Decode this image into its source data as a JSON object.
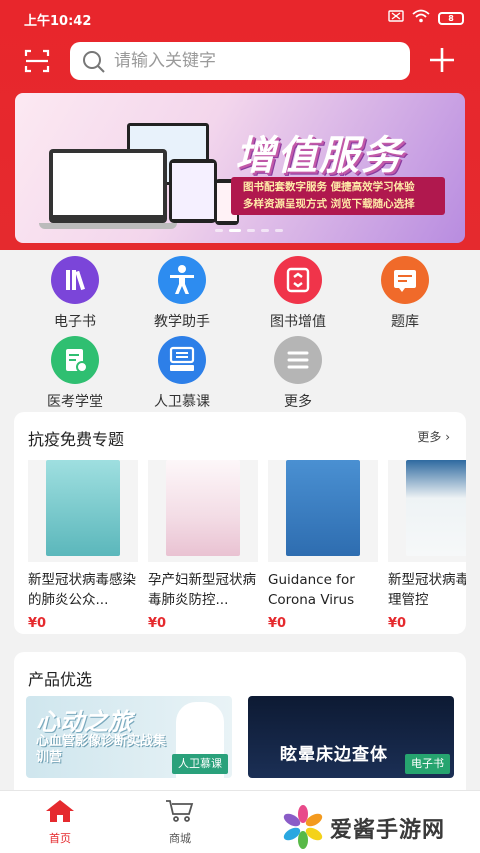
{
  "status_bar": {
    "time": "上午10:42",
    "battery": "8"
  },
  "search": {
    "placeholder": "请输入关键字"
  },
  "banner": {
    "title": "增值服务",
    "line1": "图书配套数字服务  便捷高效学习体验",
    "line2": "多样资源呈现方式  浏览下载随心选择"
  },
  "quick_menu": [
    {
      "label": "电子书",
      "icon": "ebook-icon",
      "color": "#7b45d9"
    },
    {
      "label": "教学助手",
      "icon": "teaching-assistant-icon",
      "color": "#2d8cf0"
    },
    {
      "label": "图书增值",
      "icon": "book-addon-icon",
      "color": "#f0344a"
    },
    {
      "label": "题库",
      "icon": "question-bank-icon",
      "color": "#f06a2a"
    },
    {
      "label": "医考学堂",
      "icon": "medical-exam-icon",
      "color": "#2fbf71"
    },
    {
      "label": "人卫慕课",
      "icon": "mooc-icon",
      "color": "#2d7fe8"
    },
    {
      "label": "更多",
      "icon": "more-icon",
      "color": "#b5b5b5"
    }
  ],
  "section_free": {
    "title": "抗疫免费专题",
    "more": "更多 ›",
    "books": [
      {
        "name": "新型冠状病毒感染的肺炎公众...",
        "price": "¥0",
        "color": "#6fc7c8"
      },
      {
        "name": "孕产妇新型冠状病毒肺炎防控...",
        "price": "¥0",
        "color": "#f3dde6"
      },
      {
        "name": "Guidance for Corona Virus D...",
        "price": "¥0",
        "color": "#3a7fc6"
      },
      {
        "name": "新型冠状病毒炎护理管控",
        "price": "¥0",
        "color": "#e8eef0"
      }
    ]
  },
  "section_products": {
    "title": "产品优选",
    "items": [
      {
        "title": "心动之旅",
        "sub": "心血管影像诊断实战集训营",
        "tag": "人卫慕课",
        "tag_color": "#2aa17b"
      },
      {
        "title": "眩晕床边查体",
        "tag": "电子书",
        "tag_color": "#26a46f"
      }
    ]
  },
  "tabbar": {
    "home": "首页",
    "mall": "商城"
  },
  "watermark": {
    "text": "爱酱手游网"
  },
  "colors": {
    "brand_red": "#e52a2e",
    "price_red": "#e52a2e"
  }
}
